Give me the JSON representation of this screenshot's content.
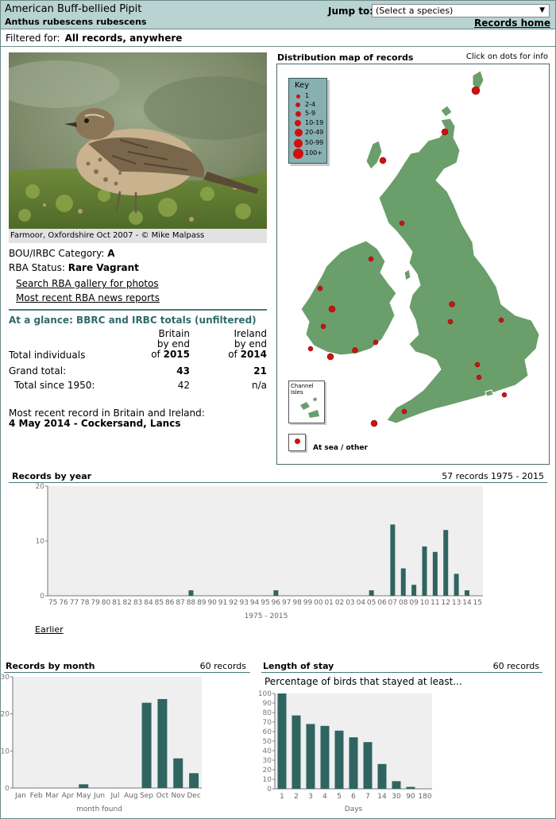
{
  "header": {
    "species_name": "American Buff-bellied Pipit",
    "latin_name": "Anthus rubescens rubescens",
    "jump_label": "Jump to:",
    "jump_select_value": "(Select a species)",
    "records_home": "Records home"
  },
  "filter": {
    "label": "Filtered for:",
    "value": "All records, anywhere"
  },
  "photo": {
    "caption": "Farmoor, Oxfordshire Oct 2007 - © Mike Malpass"
  },
  "status": {
    "bou_label": "BOU/IRBC Category:",
    "bou_value": "A",
    "rba_label": "RBA Status:",
    "rba_value": "Rare Vagrant",
    "gallery_link": "Search RBA gallery for photos",
    "news_link": "Most recent RBA news reports"
  },
  "glance": {
    "title": "At a glance: BBRC and IRBC totals (unfiltered)",
    "britain_head": [
      "Britain",
      "by end",
      "of"
    ],
    "britain_year": "2015",
    "ireland_head": [
      "Ireland",
      "by end",
      "of"
    ],
    "ireland_year": "2014",
    "total_individuals": "Total individuals",
    "grand_total_label": "Grand total:",
    "grand_total_britain": "43",
    "grand_total_ireland": "21",
    "since_label": "Total since 1950:",
    "since_britain": "42",
    "since_ireland": "n/a",
    "recent_label": "Most recent record in Britain and Ireland:",
    "recent_value": "4 May 2014  - Cockersand, Lancs"
  },
  "map": {
    "title": "Distribution map of records",
    "hint": "Click on dots for info",
    "key_title": "Key",
    "key_items": [
      "1",
      "2-4",
      "5-9",
      "10-19",
      "20-49",
      "50-99",
      "100+"
    ],
    "channel_isles": "Channel Isles",
    "at_sea": "At sea / other",
    "land_color": "#6a9e6a",
    "dot_color": "#d01010"
  },
  "year_chart": {
    "section_title": "Records by year",
    "summary": "57 records 1975 - 2015",
    "earlier_link": "Earlier",
    "chart_data": {
      "type": "bar",
      "title": "Records by year",
      "xlabel": "1975 - 2015",
      "ylabel": "",
      "ylim": [
        0,
        20
      ],
      "yticks": [
        0,
        10,
        20
      ],
      "categories": [
        "75",
        "76",
        "77",
        "78",
        "79",
        "80",
        "81",
        "82",
        "83",
        "84",
        "85",
        "86",
        "87",
        "88",
        "89",
        "90",
        "91",
        "92",
        "93",
        "94",
        "95",
        "96",
        "97",
        "98",
        "99",
        "00",
        "01",
        "02",
        "03",
        "04",
        "05",
        "06",
        "07",
        "08",
        "09",
        "10",
        "11",
        "12",
        "13",
        "14",
        "15"
      ],
      "values": [
        0,
        0,
        0,
        0,
        0,
        0,
        0,
        0,
        0,
        0,
        0,
        0,
        0,
        1,
        0,
        0,
        0,
        0,
        0,
        0,
        0,
        1,
        0,
        0,
        0,
        0,
        0,
        0,
        0,
        0,
        1,
        0,
        13,
        5,
        2,
        9,
        8,
        12,
        4,
        1,
        0
      ]
    }
  },
  "month_chart": {
    "section_title": "Records by month",
    "summary": "60 records",
    "chart_data": {
      "type": "bar",
      "title": "Records by month",
      "xlabel": "month found",
      "ylabel": "",
      "ylim": [
        0,
        30
      ],
      "yticks": [
        0,
        10,
        20,
        30
      ],
      "categories": [
        "Jan",
        "Feb",
        "Mar",
        "Apr",
        "May",
        "Jun",
        "Jul",
        "Aug",
        "Sep",
        "Oct",
        "Nov",
        "Dec"
      ],
      "values": [
        0,
        0,
        0,
        0,
        1,
        0,
        0,
        0,
        23,
        24,
        8,
        4
      ]
    }
  },
  "stay_chart": {
    "section_title": "Length of stay",
    "summary": "60 records",
    "subtitle": "Percentage of birds that stayed at least...",
    "chart_data": {
      "type": "bar",
      "title": "Length of stay",
      "xlabel": "Days",
      "ylabel": "",
      "ylim": [
        0,
        100
      ],
      "yticks": [
        0,
        10,
        20,
        30,
        40,
        50,
        60,
        70,
        80,
        90,
        100
      ],
      "categories": [
        "1",
        "2",
        "3",
        "4",
        "5",
        "6",
        "7",
        "14",
        "30",
        "90",
        "180"
      ],
      "values": [
        100,
        77,
        68,
        66,
        61,
        54,
        49,
        26,
        8,
        2,
        0
      ]
    }
  },
  "colors": {
    "header_bg": "#b9d3d3",
    "bar": "#2f6461",
    "chart_bg": "#efefef",
    "accent_text": "#2f6a6a"
  }
}
